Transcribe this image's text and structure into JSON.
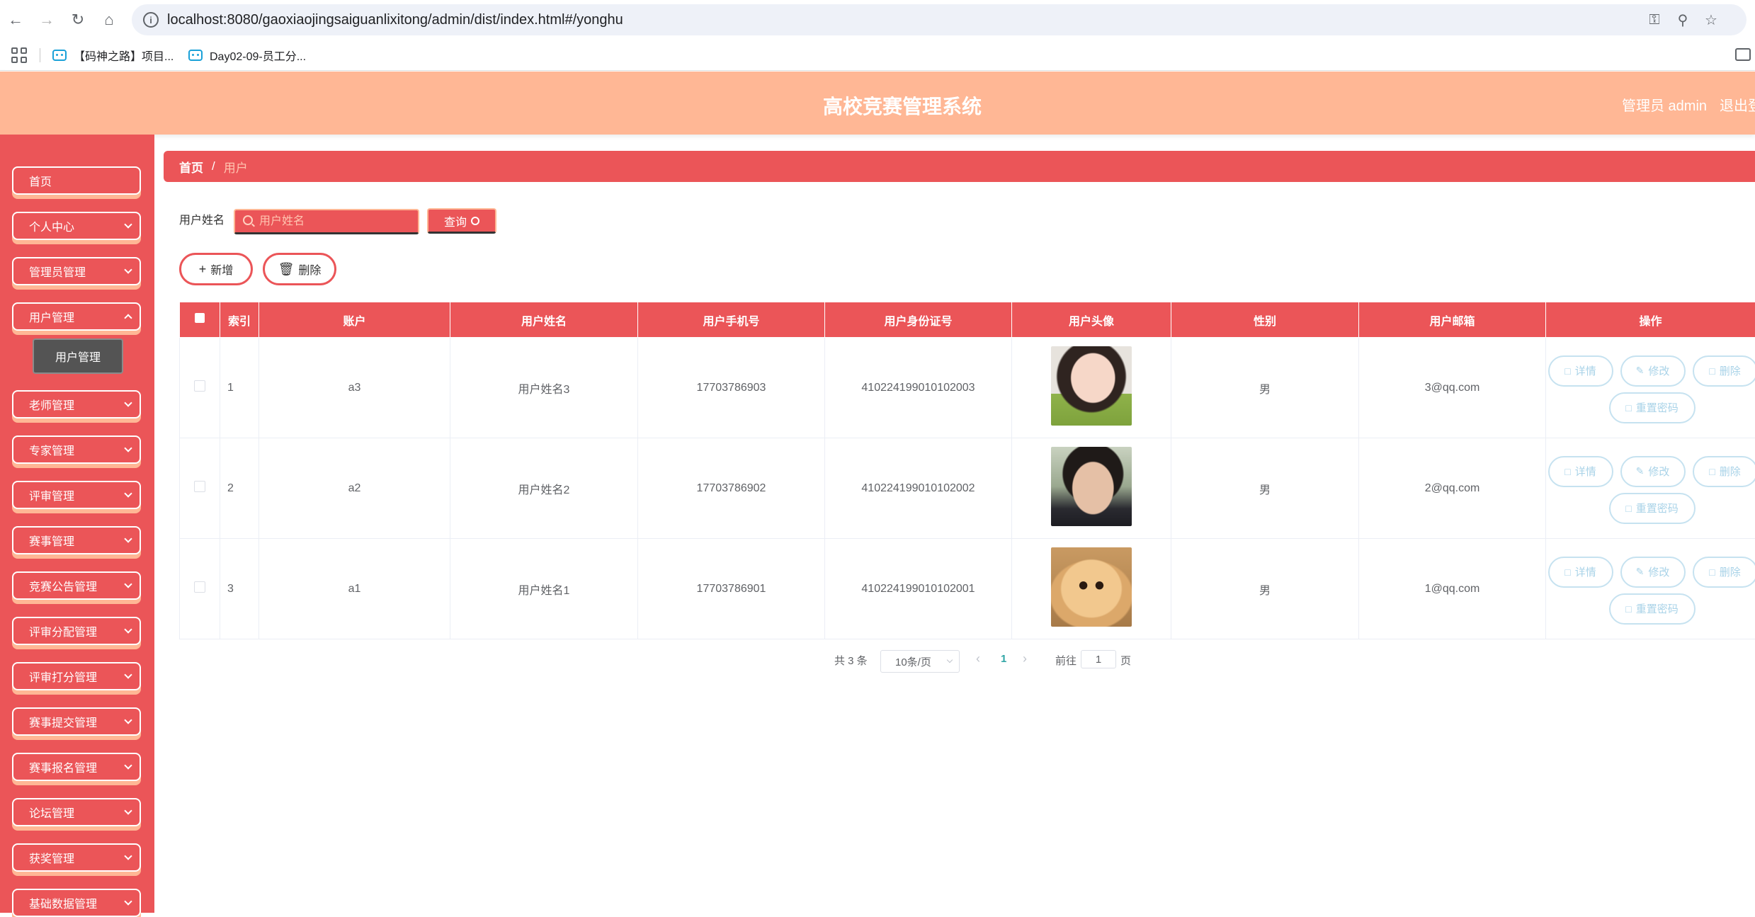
{
  "browser": {
    "url": "localhost:8080/gaoxiaojingsaiguanlixitong/admin/dist/index.html#/yonghu",
    "bookmarks": [
      {
        "label": "【码神之路】项目..."
      },
      {
        "label": "Day02-09-员工分..."
      }
    ]
  },
  "header": {
    "title": "高校竞赛管理系统",
    "user": "管理员 admin",
    "logout": "退出登"
  },
  "sidebar": {
    "items": [
      {
        "label": "首页"
      },
      {
        "label": "个人中心"
      },
      {
        "label": "管理员管理"
      },
      {
        "label": "用户管理"
      },
      {
        "label": "老师管理"
      },
      {
        "label": "专家管理"
      },
      {
        "label": "评审管理"
      },
      {
        "label": "赛事管理"
      },
      {
        "label": "竞赛公告管理"
      },
      {
        "label": "评审分配管理"
      },
      {
        "label": "评审打分管理"
      },
      {
        "label": "赛事提交管理"
      },
      {
        "label": "赛事报名管理"
      },
      {
        "label": "论坛管理"
      },
      {
        "label": "获奖管理"
      },
      {
        "label": "基础数据管理"
      }
    ],
    "submenu": {
      "label": "用户管理"
    }
  },
  "breadcrumb": {
    "home": "首页",
    "separator": "/",
    "current": "用户"
  },
  "search": {
    "label": "用户姓名",
    "placeholder": "用户姓名",
    "query_label": "查询"
  },
  "actions": {
    "add_label": "新增",
    "delete_label": "删除"
  },
  "table": {
    "headers": [
      "索引",
      "账户",
      "用户姓名",
      "用户手机号",
      "用户身份证号",
      "用户头像",
      "性别",
      "用户邮箱",
      "操作"
    ],
    "rows": [
      {
        "index": "1",
        "account": "a3",
        "name": "用户姓名3",
        "phone": "17703786903",
        "id_card": "410224199010102003",
        "avatar": "girl-photo",
        "gender": "男",
        "email": "3@qq.com"
      },
      {
        "index": "2",
        "account": "a2",
        "name": "用户姓名2",
        "phone": "17703786902",
        "id_card": "410224199010102002",
        "avatar": "boy-photo",
        "gender": "男",
        "email": "2@qq.com"
      },
      {
        "index": "3",
        "account": "a1",
        "name": "用户姓名1",
        "phone": "17703786901",
        "id_card": "410224199010102001",
        "avatar": "puppy-photo",
        "gender": "男",
        "email": "1@qq.com"
      }
    ],
    "op_labels": {
      "detail": "详情",
      "edit": "修改",
      "delete": "删除",
      "reset": "重置密码"
    }
  },
  "pagination": {
    "total": "共 3 条",
    "page_size": "10条/页",
    "current_page": "1",
    "goto_label": "前往",
    "goto_value": "1",
    "unit": "页"
  },
  "colors": {
    "primary": "#eb5558",
    "header": "#ffb795",
    "op_button": "#a9d3e8"
  }
}
